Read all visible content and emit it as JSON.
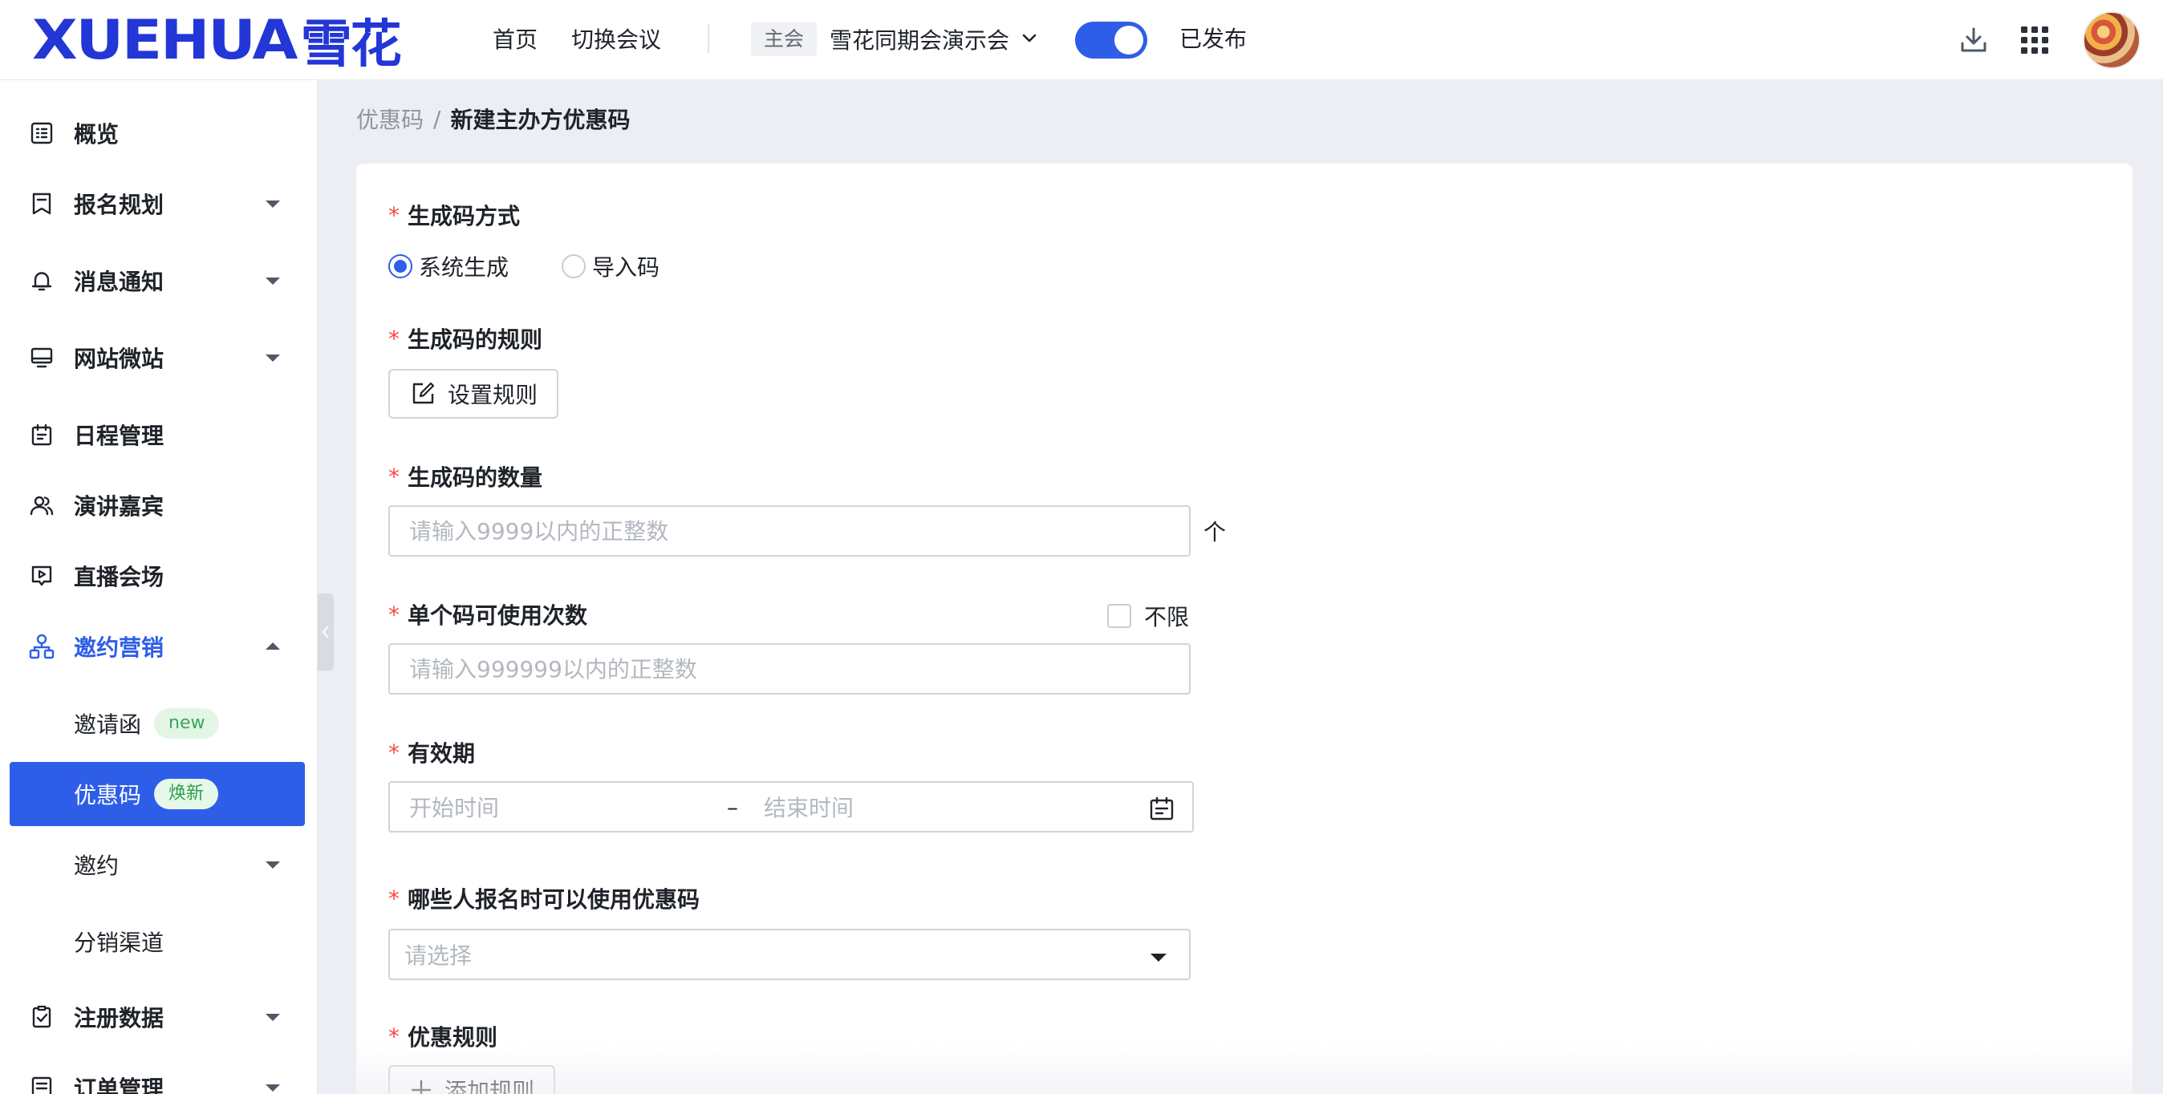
{
  "header": {
    "logo_latin": "XUEHUA",
    "logo_cjk": "雪花",
    "nav": [
      "首页",
      "切换会议"
    ],
    "meeting_tag": "主会",
    "meeting_name": "雪花同期会演示会",
    "publish_toggle_on": true,
    "publish_status": "已发布",
    "icons": [
      "download-icon",
      "apps-grid-icon",
      "avatar"
    ]
  },
  "sidebar": {
    "items": [
      {
        "label": "概览",
        "icon": "overview-icon",
        "caret": "none"
      },
      {
        "label": "报名规划",
        "icon": "bookmark-icon",
        "caret": "down"
      },
      {
        "label": "消息通知",
        "icon": "bell-icon",
        "caret": "down"
      },
      {
        "label": "网站微站",
        "icon": "monitor-icon",
        "caret": "down"
      },
      {
        "label": "日程管理",
        "icon": "calendar-icon",
        "caret": "none"
      },
      {
        "label": "演讲嘉宾",
        "icon": "users-icon",
        "caret": "none"
      },
      {
        "label": "直播会场",
        "icon": "live-icon",
        "caret": "none"
      },
      {
        "label": "邀约营销",
        "icon": "network-icon",
        "caret": "up"
      },
      {
        "label": "注册数据",
        "icon": "clipboard-check-icon",
        "caret": "down"
      },
      {
        "label": "订单管理",
        "icon": "order-icon",
        "caret": "down"
      }
    ],
    "sub_items": [
      {
        "label": "邀请函",
        "badge": "new"
      },
      {
        "label": "优惠码",
        "badge": "焕新",
        "selected": true
      },
      {
        "label": "邀约",
        "caret": "down"
      },
      {
        "label": "分销渠道"
      }
    ]
  },
  "breadcrumb": {
    "parent": "优惠码",
    "separator": "/",
    "current": "新建主办方优惠码"
  },
  "form": {
    "required_mark": "*",
    "gen_method": {
      "label": "生成码方式",
      "options": [
        "系统生成",
        "导入码"
      ],
      "selected": "系统生成"
    },
    "gen_rule": {
      "label": "生成码的规则",
      "button": "设置规则"
    },
    "quantity": {
      "label": "生成码的数量",
      "placeholder": "请输入9999以内的正整数",
      "value": "",
      "unit": "个"
    },
    "uses": {
      "label": "单个码可使用次数",
      "unlimited_label": "不限",
      "unlimited_checked": false,
      "placeholder": "请输入999999以内的正整数",
      "value": ""
    },
    "validity": {
      "label": "有效期",
      "start_placeholder": "开始时间",
      "separator": "–",
      "end_placeholder": "结束时间"
    },
    "who": {
      "label": "哪些人报名时可以使用优惠码",
      "placeholder": "请选择"
    },
    "discount": {
      "label": "优惠规则",
      "button": "添加规则"
    }
  },
  "colors": {
    "brand": "#2336d6",
    "accent": "#2e5ee8",
    "required": "#f54a45",
    "badge_green": "#3ba55c"
  }
}
